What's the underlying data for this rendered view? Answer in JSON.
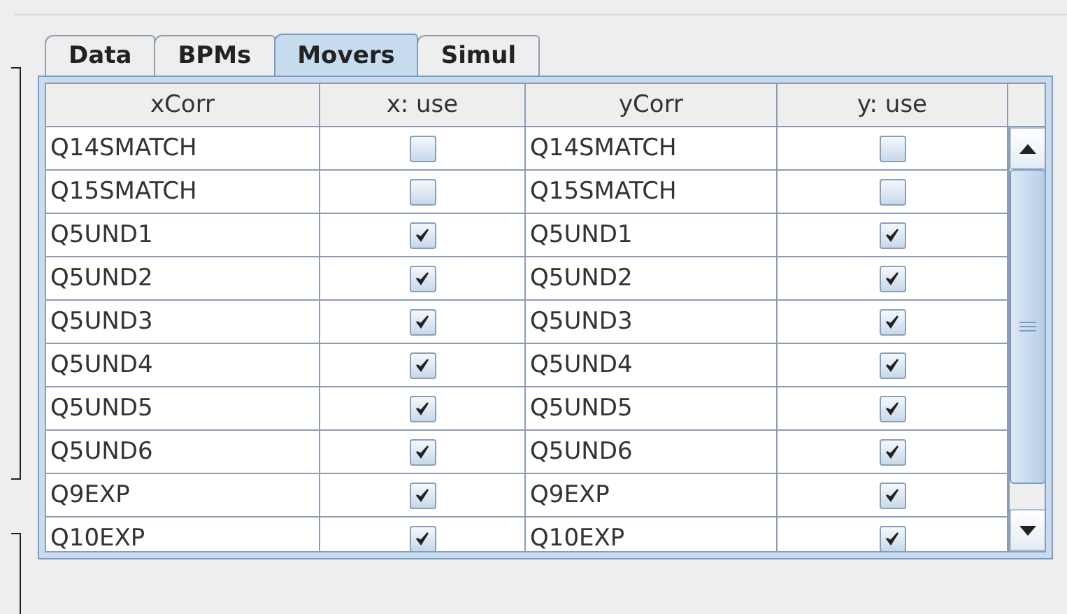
{
  "tabs": [
    {
      "label": "Data",
      "selected": false
    },
    {
      "label": "BPMs",
      "selected": false
    },
    {
      "label": "Movers",
      "selected": true
    },
    {
      "label": "Simul",
      "selected": false
    }
  ],
  "table": {
    "columns": [
      "xCorr",
      "x: use",
      "yCorr",
      "y: use"
    ],
    "rows": [
      {
        "x_corr": "Q14SMATCH",
        "x_use": false,
        "y_corr": "Q14SMATCH",
        "y_use": false
      },
      {
        "x_corr": "Q15SMATCH",
        "x_use": false,
        "y_corr": "Q15SMATCH",
        "y_use": false
      },
      {
        "x_corr": "Q5UND1",
        "x_use": true,
        "y_corr": "Q5UND1",
        "y_use": true
      },
      {
        "x_corr": "Q5UND2",
        "x_use": true,
        "y_corr": "Q5UND2",
        "y_use": true
      },
      {
        "x_corr": "Q5UND3",
        "x_use": true,
        "y_corr": "Q5UND3",
        "y_use": true
      },
      {
        "x_corr": "Q5UND4",
        "x_use": true,
        "y_corr": "Q5UND4",
        "y_use": true
      },
      {
        "x_corr": "Q5UND5",
        "x_use": true,
        "y_corr": "Q5UND5",
        "y_use": true
      },
      {
        "x_corr": "Q5UND6",
        "x_use": true,
        "y_corr": "Q5UND6",
        "y_use": true
      },
      {
        "x_corr": "Q9EXP",
        "x_use": true,
        "y_corr": "Q9EXP",
        "y_use": true
      },
      {
        "x_corr": "Q10EXP",
        "x_use": true,
        "y_corr": "Q10EXP",
        "y_use": true
      }
    ]
  }
}
